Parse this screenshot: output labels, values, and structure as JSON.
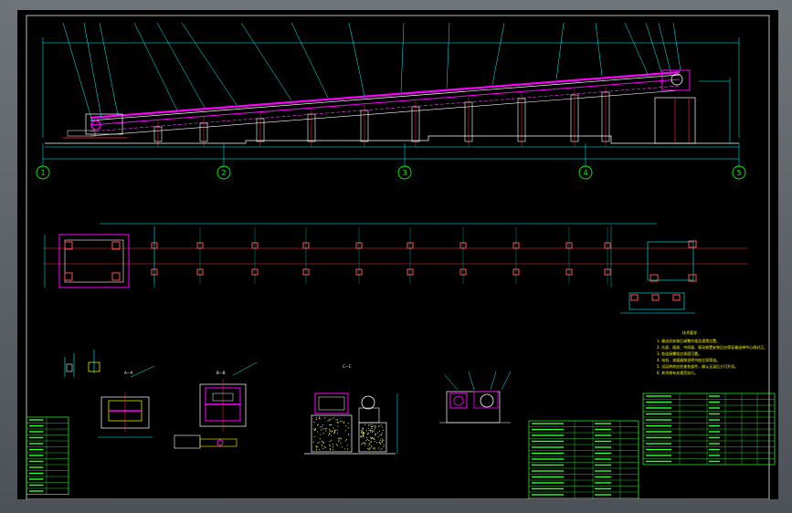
{
  "drawing": {
    "background": "#000000",
    "colors": {
      "frame": "#ffffff",
      "dimension": "#00ffff",
      "belt": "#ff00ff",
      "axis": "#ff2020",
      "leader": "#00ff00",
      "notes": "#ffff00",
      "hatch": "#ffff66"
    }
  },
  "axis_labels": [
    "1",
    "2",
    "3",
    "4",
    "5"
  ],
  "section_labels": {
    "a": "A—A",
    "b": "B—B",
    "c": "C—C"
  },
  "notes": {
    "title": "技术要求",
    "lines": [
      "1. 输送机安装后调整托辊及滚筒位置。",
      "2. 头部、尾部、中间架、驱动装置安装后应保证输送带中心线对正。",
      "3. 各连接螺栓应紧固可靠。",
      "4. 电机、减速器按说明书加注润滑油。",
      "5. 试运转前应检查各部件，确认无误后方可开机。",
      "6. 其余按有关规范执行。"
    ]
  }
}
